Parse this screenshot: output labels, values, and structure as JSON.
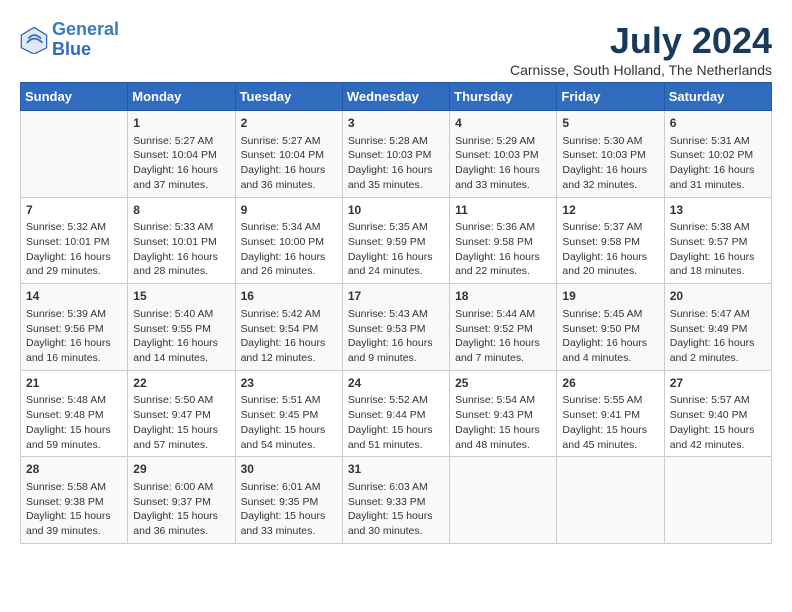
{
  "header": {
    "logo_line1": "General",
    "logo_line2": "Blue",
    "title": "July 2024",
    "subtitle": "Carnisse, South Holland, The Netherlands"
  },
  "weekdays": [
    "Sunday",
    "Monday",
    "Tuesday",
    "Wednesday",
    "Thursday",
    "Friday",
    "Saturday"
  ],
  "weeks": [
    [
      {
        "day": "",
        "info": ""
      },
      {
        "day": "1",
        "info": "Sunrise: 5:27 AM\nSunset: 10:04 PM\nDaylight: 16 hours\nand 37 minutes."
      },
      {
        "day": "2",
        "info": "Sunrise: 5:27 AM\nSunset: 10:04 PM\nDaylight: 16 hours\nand 36 minutes."
      },
      {
        "day": "3",
        "info": "Sunrise: 5:28 AM\nSunset: 10:03 PM\nDaylight: 16 hours\nand 35 minutes."
      },
      {
        "day": "4",
        "info": "Sunrise: 5:29 AM\nSunset: 10:03 PM\nDaylight: 16 hours\nand 33 minutes."
      },
      {
        "day": "5",
        "info": "Sunrise: 5:30 AM\nSunset: 10:03 PM\nDaylight: 16 hours\nand 32 minutes."
      },
      {
        "day": "6",
        "info": "Sunrise: 5:31 AM\nSunset: 10:02 PM\nDaylight: 16 hours\nand 31 minutes."
      }
    ],
    [
      {
        "day": "7",
        "info": "Sunrise: 5:32 AM\nSunset: 10:01 PM\nDaylight: 16 hours\nand 29 minutes."
      },
      {
        "day": "8",
        "info": "Sunrise: 5:33 AM\nSunset: 10:01 PM\nDaylight: 16 hours\nand 28 minutes."
      },
      {
        "day": "9",
        "info": "Sunrise: 5:34 AM\nSunset: 10:00 PM\nDaylight: 16 hours\nand 26 minutes."
      },
      {
        "day": "10",
        "info": "Sunrise: 5:35 AM\nSunset: 9:59 PM\nDaylight: 16 hours\nand 24 minutes."
      },
      {
        "day": "11",
        "info": "Sunrise: 5:36 AM\nSunset: 9:58 PM\nDaylight: 16 hours\nand 22 minutes."
      },
      {
        "day": "12",
        "info": "Sunrise: 5:37 AM\nSunset: 9:58 PM\nDaylight: 16 hours\nand 20 minutes."
      },
      {
        "day": "13",
        "info": "Sunrise: 5:38 AM\nSunset: 9:57 PM\nDaylight: 16 hours\nand 18 minutes."
      }
    ],
    [
      {
        "day": "14",
        "info": "Sunrise: 5:39 AM\nSunset: 9:56 PM\nDaylight: 16 hours\nand 16 minutes."
      },
      {
        "day": "15",
        "info": "Sunrise: 5:40 AM\nSunset: 9:55 PM\nDaylight: 16 hours\nand 14 minutes."
      },
      {
        "day": "16",
        "info": "Sunrise: 5:42 AM\nSunset: 9:54 PM\nDaylight: 16 hours\nand 12 minutes."
      },
      {
        "day": "17",
        "info": "Sunrise: 5:43 AM\nSunset: 9:53 PM\nDaylight: 16 hours\nand 9 minutes."
      },
      {
        "day": "18",
        "info": "Sunrise: 5:44 AM\nSunset: 9:52 PM\nDaylight: 16 hours\nand 7 minutes."
      },
      {
        "day": "19",
        "info": "Sunrise: 5:45 AM\nSunset: 9:50 PM\nDaylight: 16 hours\nand 4 minutes."
      },
      {
        "day": "20",
        "info": "Sunrise: 5:47 AM\nSunset: 9:49 PM\nDaylight: 16 hours\nand 2 minutes."
      }
    ],
    [
      {
        "day": "21",
        "info": "Sunrise: 5:48 AM\nSunset: 9:48 PM\nDaylight: 15 hours\nand 59 minutes."
      },
      {
        "day": "22",
        "info": "Sunrise: 5:50 AM\nSunset: 9:47 PM\nDaylight: 15 hours\nand 57 minutes."
      },
      {
        "day": "23",
        "info": "Sunrise: 5:51 AM\nSunset: 9:45 PM\nDaylight: 15 hours\nand 54 minutes."
      },
      {
        "day": "24",
        "info": "Sunrise: 5:52 AM\nSunset: 9:44 PM\nDaylight: 15 hours\nand 51 minutes."
      },
      {
        "day": "25",
        "info": "Sunrise: 5:54 AM\nSunset: 9:43 PM\nDaylight: 15 hours\nand 48 minutes."
      },
      {
        "day": "26",
        "info": "Sunrise: 5:55 AM\nSunset: 9:41 PM\nDaylight: 15 hours\nand 45 minutes."
      },
      {
        "day": "27",
        "info": "Sunrise: 5:57 AM\nSunset: 9:40 PM\nDaylight: 15 hours\nand 42 minutes."
      }
    ],
    [
      {
        "day": "28",
        "info": "Sunrise: 5:58 AM\nSunset: 9:38 PM\nDaylight: 15 hours\nand 39 minutes."
      },
      {
        "day": "29",
        "info": "Sunrise: 6:00 AM\nSunset: 9:37 PM\nDaylight: 15 hours\nand 36 minutes."
      },
      {
        "day": "30",
        "info": "Sunrise: 6:01 AM\nSunset: 9:35 PM\nDaylight: 15 hours\nand 33 minutes."
      },
      {
        "day": "31",
        "info": "Sunrise: 6:03 AM\nSunset: 9:33 PM\nDaylight: 15 hours\nand 30 minutes."
      },
      {
        "day": "",
        "info": ""
      },
      {
        "day": "",
        "info": ""
      },
      {
        "day": "",
        "info": ""
      }
    ]
  ]
}
